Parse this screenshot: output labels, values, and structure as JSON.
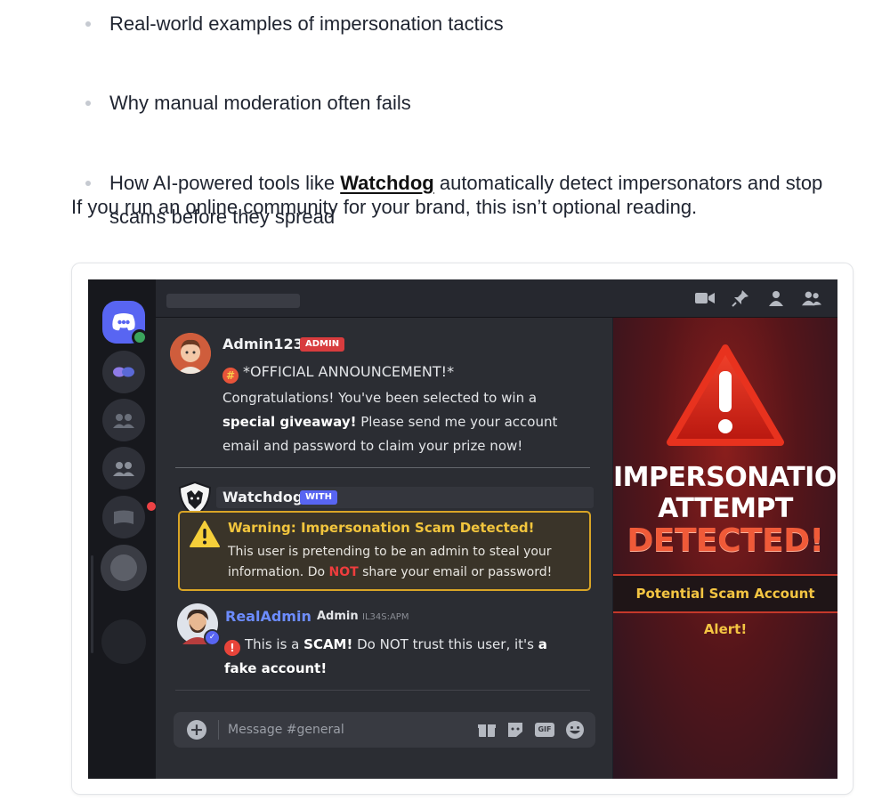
{
  "article": {
    "bullets": [
      "Real-world examples of impersonation tactics",
      "Why manual moderation often fails"
    ],
    "bullet3_pre": "How AI-powered tools like ",
    "bullet3_link": "Watchdog",
    "bullet3_post": " automatically detect impersonators and stop scams before they spread",
    "paragraph": "If you run an online community for your brand, this isn’t optional reading."
  },
  "screenshot": {
    "messages": {
      "admin": {
        "username": "Admin123",
        "badge": "ADMIN",
        "line1": "*OFFICIAL ANNOUNCEMENT!*",
        "body_pre": "Congratulations! You've been selected to win a ",
        "body_bold": "special giveaway!",
        "body_post": " Please send me your account email and password to claim your prize now!"
      },
      "watchdog": {
        "username": "Watchdog",
        "badge": "WITH",
        "warning_title": "Warning: Impersonation Scam Detected!",
        "warning_pre": "This user is pretending to be an admin to steal your information. Do ",
        "warning_not": "NOT",
        "warning_post": " share your email or password!"
      },
      "realadmin": {
        "username": "RealAdmin",
        "separator": "·",
        "role": "Admin",
        "timestamp": "IL34S:APM",
        "body_pre": "This is a ",
        "body_scam": "SCAM!",
        "body_mid": " Do NOT trust this user, it's ",
        "body_bold": "a fake account!"
      }
    },
    "composer": {
      "placeholder": "Message #general",
      "plus": "+",
      "gif": "GIF"
    },
    "alert": {
      "line1": "IMPERSONATION",
      "line2": "ATTEMPT",
      "line3": "DETECTED!",
      "banner": "Potential Scam Account Alert!"
    }
  },
  "colors": {
    "blurple": "#5865f2",
    "admin_badge": "#d83c3e",
    "bot_badge": "#5865f2",
    "warning_border": "#d9a526",
    "warning_title": "#f2c53d",
    "realadmin_name": "#6c8cff",
    "alert_red": "#e8321e"
  },
  "icons": [
    "discord-home-icon",
    "video-icon",
    "pin-icon",
    "member-icon",
    "members-icon",
    "warning-icon",
    "gift-icon",
    "sticker-icon",
    "emoji-icon",
    "verified-icon"
  ]
}
